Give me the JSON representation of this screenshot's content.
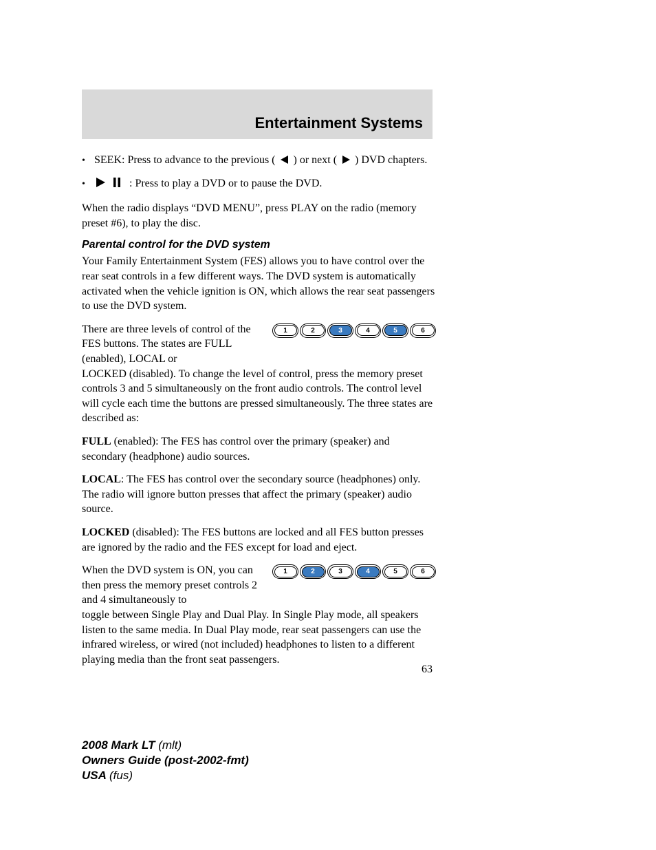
{
  "header": {
    "title": "Entertainment Systems"
  },
  "bullets": {
    "seek_1": "SEEK: Press to advance to the previous (",
    "seek_2": ") or next (",
    "seek_3": ") DVD chapters.",
    "playpause": ": Press to play a DVD or to pause the DVD."
  },
  "para_dvdmenu": "When the radio displays “DVD MENU”, press PLAY on the radio (memory preset #6), to play the disc.",
  "subheading": "Parental control for the DVD system",
  "para_intro": "Your Family Entertainment System (FES) allows you to have control over the rear seat controls in a few different ways. The DVD system is automatically activated when the vehicle ignition is ON, which allows the rear seat passengers to use the DVD system.",
  "para_levels_1": "There are three levels of control of the FES buttons. The states are FULL (enabled), LOCAL or",
  "para_levels_2": "LOCKED (disabled). To change the level of control, press the memory preset controls 3 and 5 simultaneously on the front audio controls. The control level will cycle each time the buttons are pressed simultaneously. The three states are described as:",
  "full_label": "FULL",
  "full_text": " (enabled): The FES has control over the primary (speaker) and secondary (headphone) audio sources.",
  "local_label": "LOCAL",
  "local_text": ": The FES has control over the secondary source (headphones) only. The radio will ignore button presses that affect the primary (speaker) audio source.",
  "locked_label": "LOCKED",
  "locked_text": " (disabled): The FES buttons are locked and all FES button presses are ignored by the radio and the FES except for load and eject.",
  "para_dual_1": "When the DVD system is ON, you can then press the memory preset controls 2 and 4 simultaneously to",
  "para_dual_2": "toggle between Single Play and Dual Play. In Single Play mode, all speakers listen to the same media. In Dual Play mode, rear seat passengers can use the infrared wireless, or wired (not included) headphones to listen to a different playing media than the front seat passengers.",
  "presets1": [
    {
      "n": "1",
      "hl": false
    },
    {
      "n": "2",
      "hl": false
    },
    {
      "n": "3",
      "hl": true
    },
    {
      "n": "4",
      "hl": false
    },
    {
      "n": "5",
      "hl": true
    },
    {
      "n": "6",
      "hl": false
    }
  ],
  "presets2": [
    {
      "n": "1",
      "hl": false
    },
    {
      "n": "2",
      "hl": true
    },
    {
      "n": "3",
      "hl": false
    },
    {
      "n": "4",
      "hl": true
    },
    {
      "n": "5",
      "hl": false
    },
    {
      "n": "6",
      "hl": false
    }
  ],
  "page_number": "63",
  "footer": {
    "l1a": "2008 Mark LT ",
    "l1b": "(mlt)",
    "l2a": "Owners Guide (post-2002-fmt)",
    "l3a": "USA ",
    "l3b": "(fus)"
  }
}
